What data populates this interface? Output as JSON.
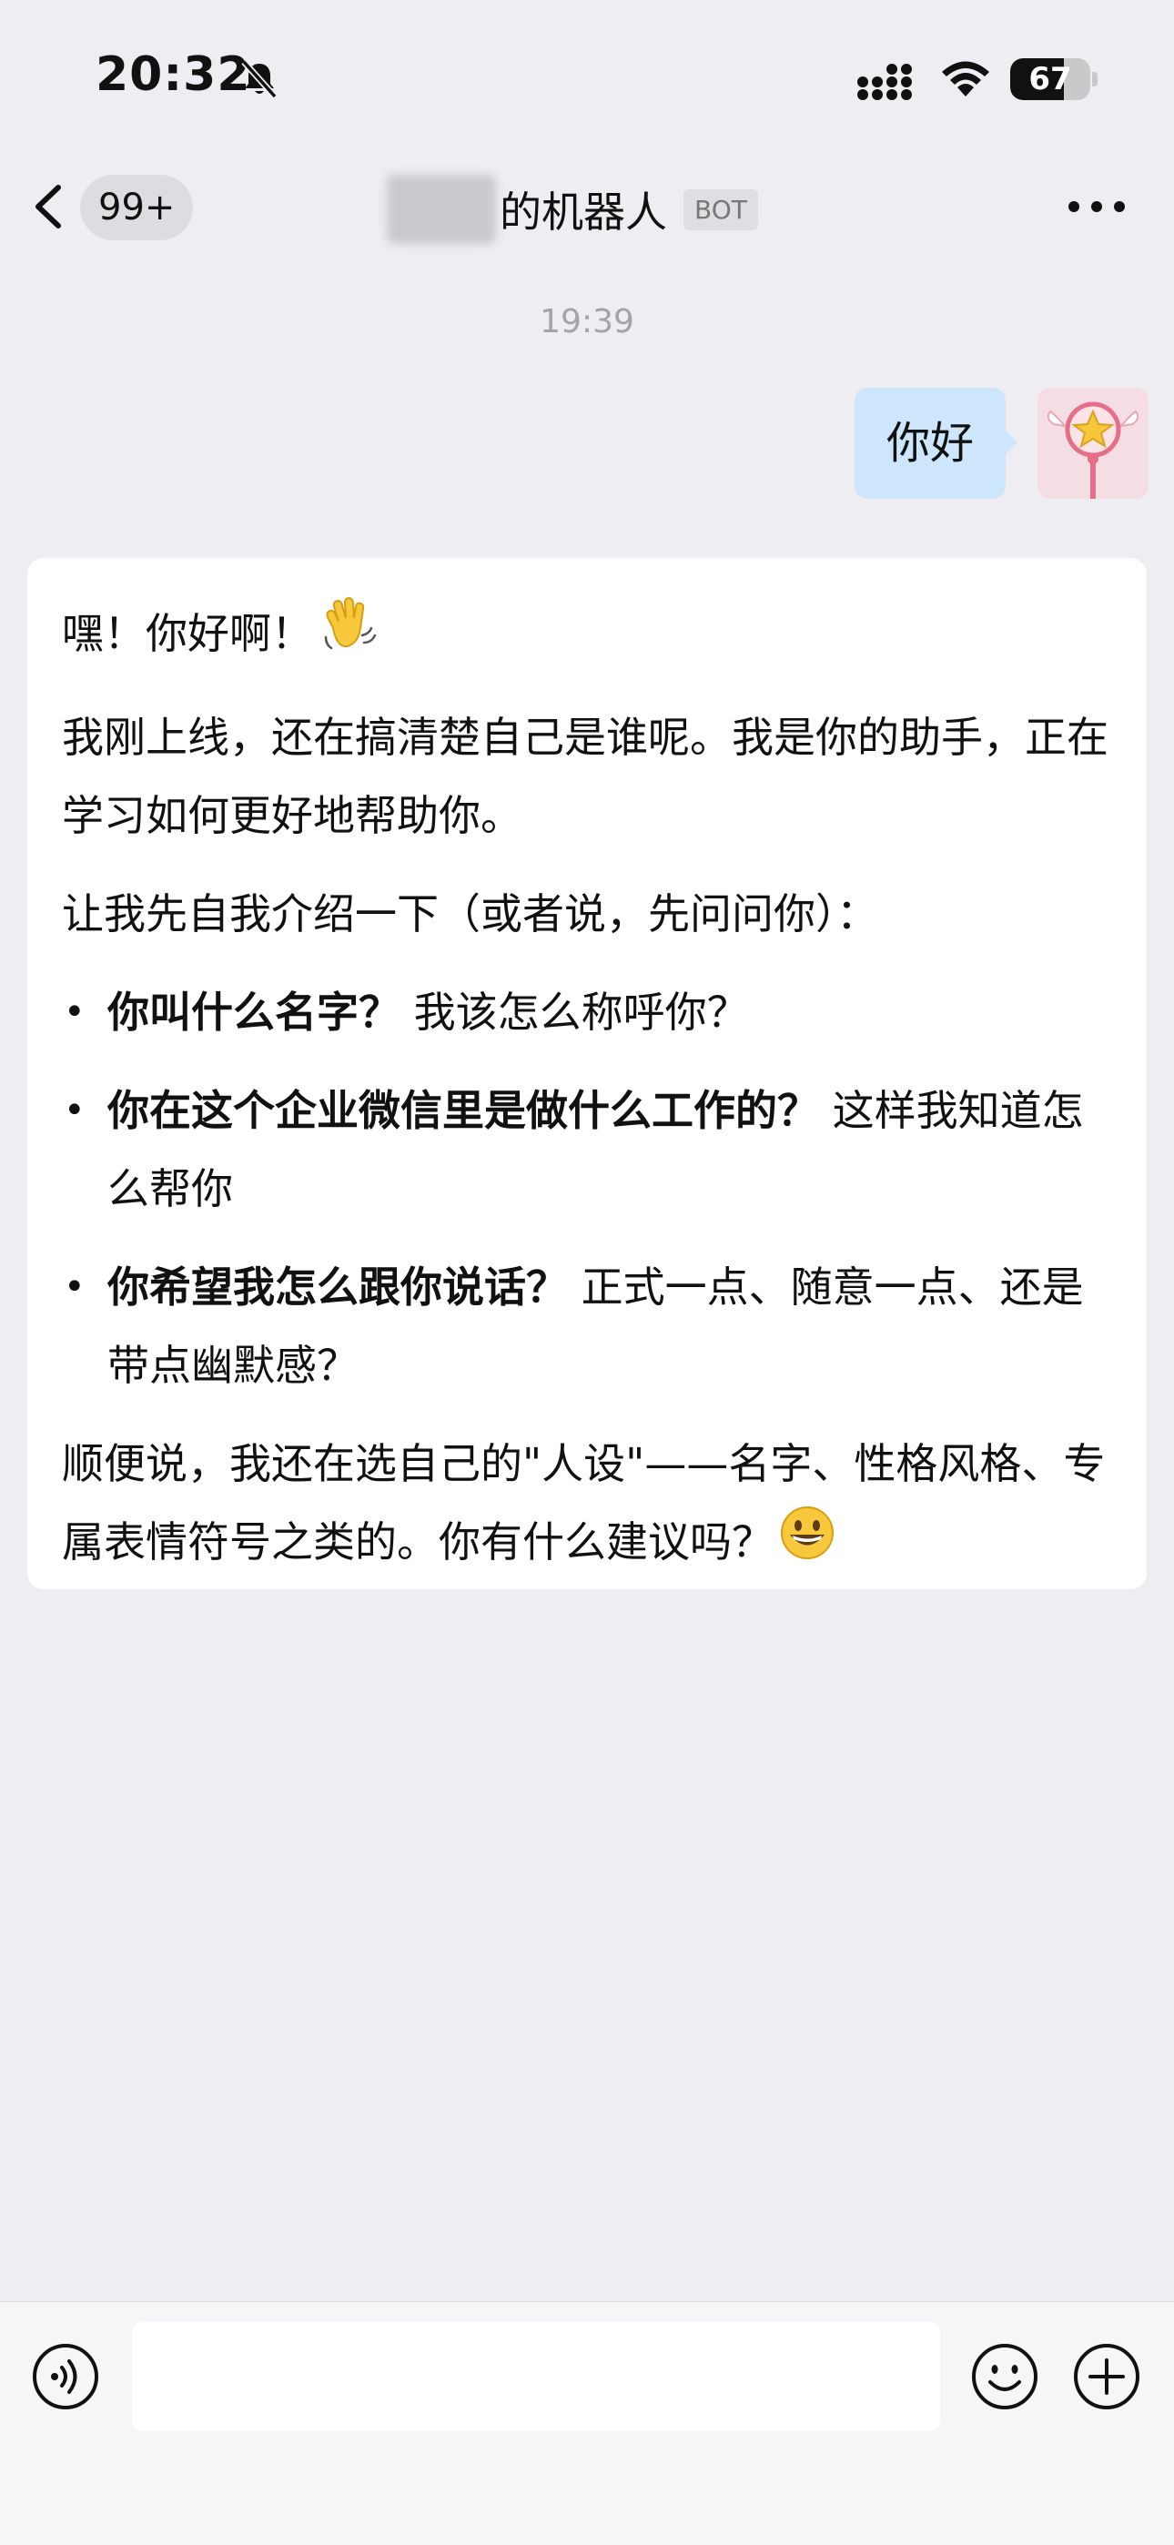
{
  "status_bar": {
    "time": "20:32",
    "battery_level": "67",
    "battery_fraction": 0.67
  },
  "nav": {
    "unread_badge": "99+",
    "title_suffix": "的机器人",
    "bot_tag": "BOT"
  },
  "chat": {
    "timestamp": "19:39",
    "outgoing": {
      "text": "你好"
    },
    "incoming": {
      "greeting": "嘿！你好啊！",
      "greeting_emoji": "👋",
      "para1": "我刚上线，还在搞清楚自己是谁呢。我是你的助手，正在学习如何更好地帮助你。",
      "para2": "让我先自我介绍一下（或者说，先问问你）：",
      "bullets": [
        {
          "bold": "你叫什么名字？",
          "text": " 我该怎么称呼你？"
        },
        {
          "bold": "你在这个企业微信里是做什么工作的？",
          "text": " 这样我知道怎么帮你"
        },
        {
          "bold": "你希望我怎么跟你说话？",
          "text": " 正式一点、随意一点、还是带点幽默感？"
        }
      ],
      "closing": "顺便说，我还在选自己的\"人设\"——名字、性格风格、专属表情符号之类的。你有什么建议吗？",
      "closing_emoji": "😄"
    }
  },
  "input_bar": {
    "placeholder": ""
  },
  "colors": {
    "background": "#ededf2",
    "outgoing_bubble": "#cde6fb",
    "incoming_bubble": "#ffffff"
  }
}
